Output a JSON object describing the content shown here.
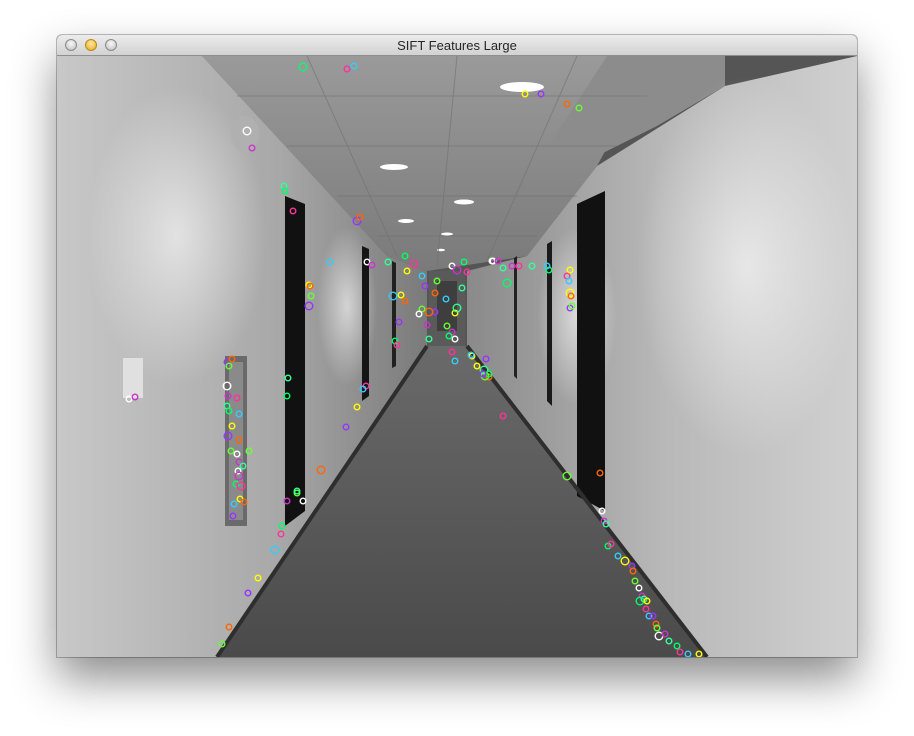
{
  "window": {
    "title": "SIFT Features Large",
    "buttons": {
      "close": "close-button",
      "minimize": "minimize-button",
      "zoom": "zoom-button"
    }
  },
  "image": {
    "description_icon": "corridor-image",
    "keypoint_colors": [
      "#00ff66",
      "#ff3399",
      "#33ccff",
      "#ffff00",
      "#9933ff",
      "#ff6600",
      "#66ff33",
      "#ffffff",
      "#cc33cc",
      "#33ff99"
    ]
  }
}
